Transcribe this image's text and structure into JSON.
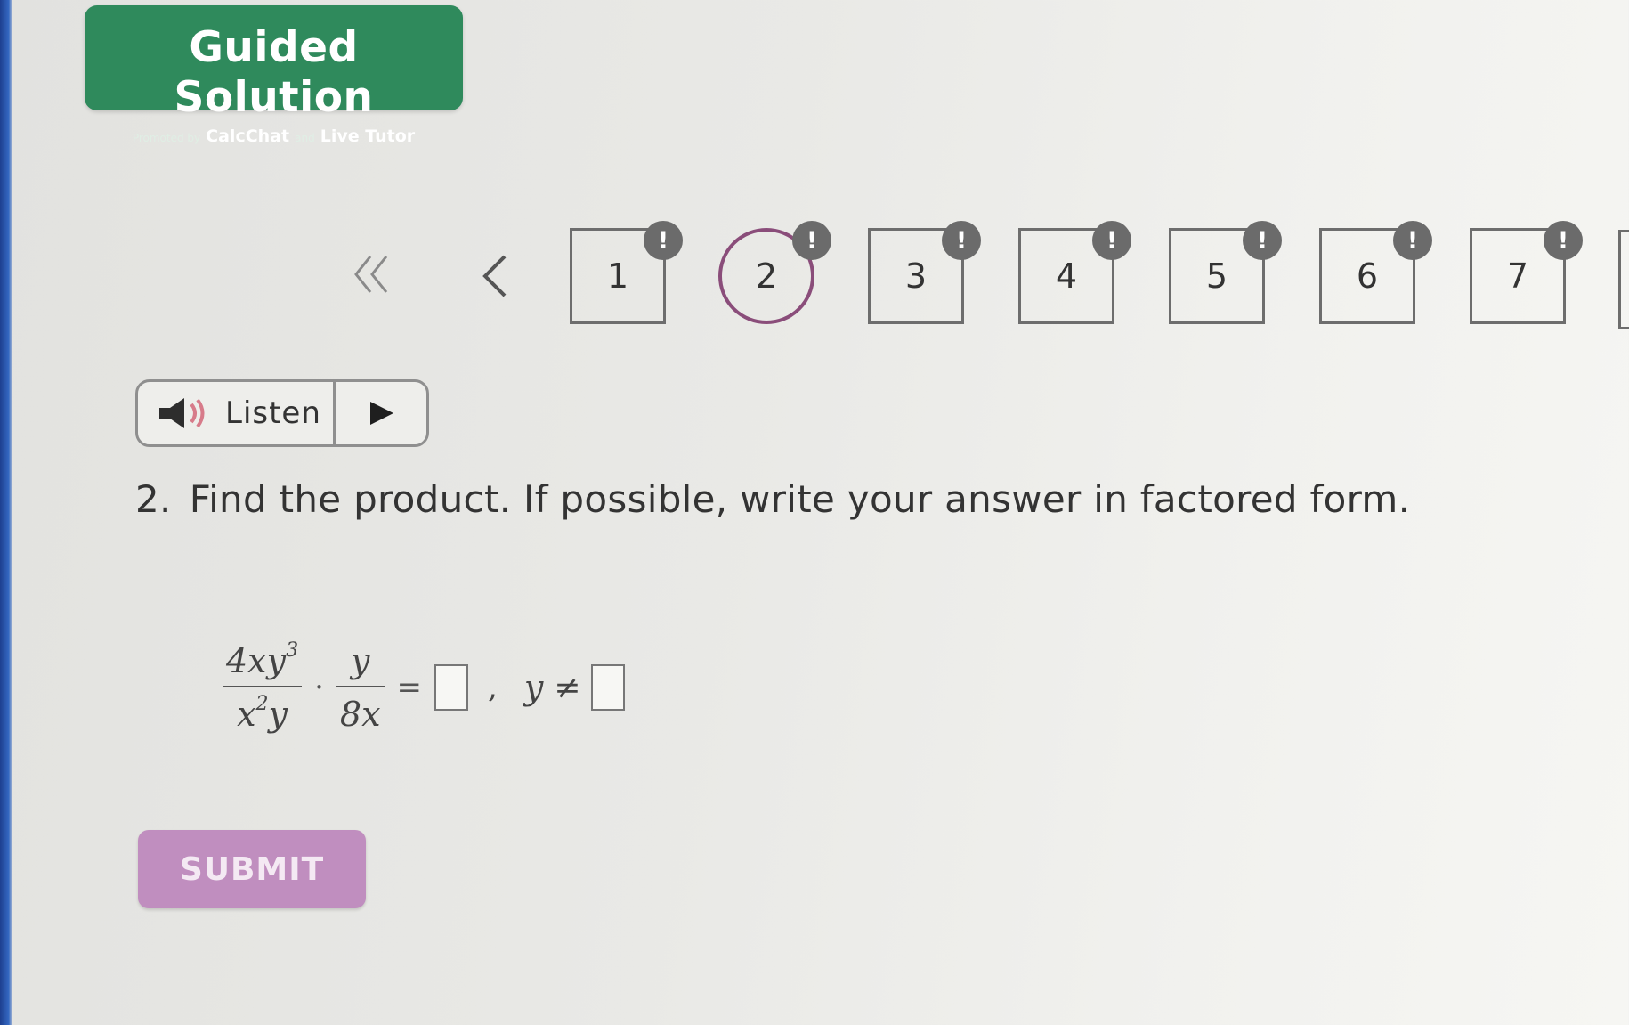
{
  "banner": {
    "title": "Guided Solution",
    "subtitle_prefix": "Promoted by",
    "subtitle_brand1": "CalcChat",
    "subtitle_and": "and",
    "subtitle_brand2": "Live Tutor"
  },
  "pagination": {
    "first_icon": "double-chevron-left-icon",
    "prev_icon": "chevron-left-icon",
    "current_step": 2,
    "badge_symbol": "!",
    "steps": [
      {
        "label": "1"
      },
      {
        "label": "2"
      },
      {
        "label": "3"
      },
      {
        "label": "4"
      },
      {
        "label": "5"
      },
      {
        "label": "6"
      },
      {
        "label": "7"
      }
    ]
  },
  "listen": {
    "label": "Listen",
    "speaker_icon": "speaker-icon",
    "play_icon": "play-icon"
  },
  "question": {
    "number": "2.",
    "text": "Find the product. If possible, write your answer in factored form."
  },
  "expression": {
    "frac1_num": "4xy",
    "frac1_num_exp": "3",
    "frac1_den_base": "x",
    "frac1_den_exp": "2",
    "frac1_den_tail": "y",
    "dot": "·",
    "frac2_num": "y",
    "frac2_den": "8x",
    "equals": "=",
    "comma": ",",
    "restriction_var": "y",
    "neq": "≠"
  },
  "submit": {
    "label": "SUBMIT"
  },
  "colors": {
    "banner_green": "#2f8a5c",
    "current_step_border": "#8a4d7a",
    "submit_purple": "#c08ebf",
    "badge_gray": "#6b6b6b"
  }
}
